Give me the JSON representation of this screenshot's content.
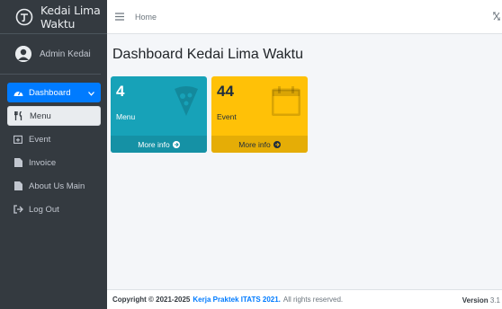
{
  "brand": {
    "name": "Kedai Lima Waktu"
  },
  "user": {
    "name": "Admin Kedai"
  },
  "sidebar": {
    "items": [
      {
        "label": "Dashboard",
        "icon": "dashboard-icon"
      },
      {
        "label": "Menu",
        "icon": "utensils-icon"
      },
      {
        "label": "Event",
        "icon": "calendar-plus-icon"
      },
      {
        "label": "Invoice",
        "icon": "file-icon"
      },
      {
        "label": "About Us Main",
        "icon": "file-icon"
      },
      {
        "label": "Log Out",
        "icon": "sign-out-icon"
      }
    ]
  },
  "header": {
    "home_label": "Home"
  },
  "main": {
    "title": "Dashboard Kedai Lima Waktu",
    "boxes": [
      {
        "count": "4",
        "label": "Menu",
        "footer": "More info",
        "color": "#17a2b8",
        "icon": "pizza-icon"
      },
      {
        "count": "44",
        "label": "Event",
        "footer": "More info",
        "color": "#ffc107",
        "icon": "calendar-icon"
      }
    ]
  },
  "footer": {
    "copyright_prefix": "Copyright © 2021-2025",
    "link_text": "Kerja Praktek ITATS 2021.",
    "rights": "All rights reserved.",
    "version_label": "Version",
    "version_value": "3.1"
  }
}
